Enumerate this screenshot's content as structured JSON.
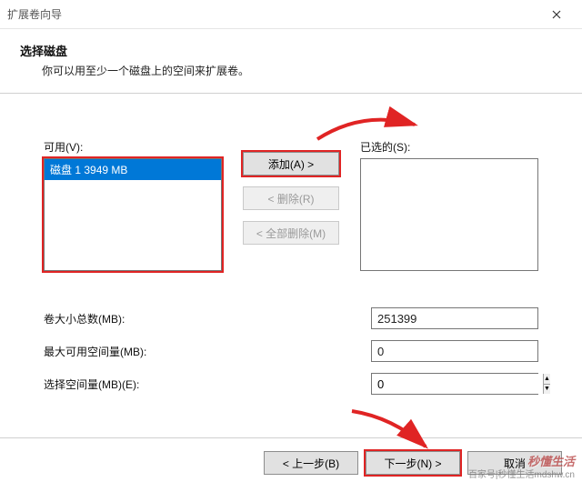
{
  "window": {
    "title": "扩展卷向导",
    "heading": "选择磁盘",
    "subheading": "你可以用至少一个磁盘上的空间来扩展卷。"
  },
  "labels": {
    "available": "可用(V):",
    "selected": "已选的(S):",
    "add": "添加(A) >",
    "remove": "< 删除(R)",
    "remove_all": "< 全部删除(M)",
    "total": "卷大小总数(MB):",
    "max": "最大可用空间量(MB):",
    "choose": "选择空间量(MB)(E):",
    "back": "< 上一步(B)",
    "next": "下一步(N) >",
    "cancel": "取消"
  },
  "available_list": [
    {
      "text": "磁盘 1     3949 MB",
      "selected": true
    }
  ],
  "selected_list": [],
  "values": {
    "total": "251399",
    "max": "0",
    "choose": "0"
  },
  "watermark": {
    "big": "秒懂生活",
    "small": "百家号|秒懂生活mdshw.cn"
  }
}
